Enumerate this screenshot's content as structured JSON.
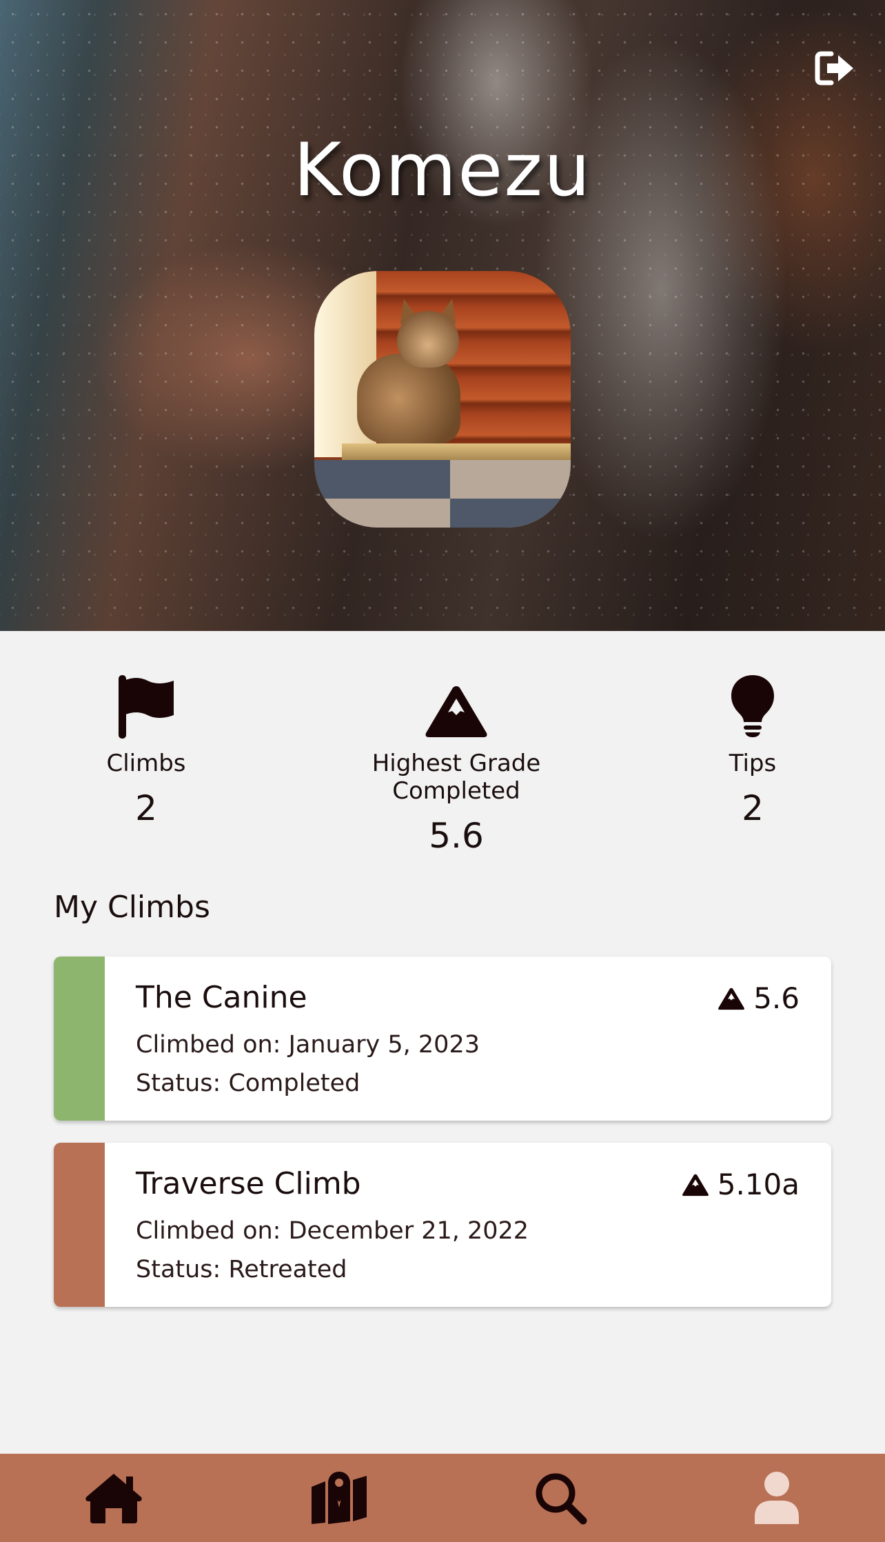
{
  "profile": {
    "username": "Komezu",
    "avatar_alt": "cat on stairs profile photo",
    "logout_icon": "logout-icon"
  },
  "stats": {
    "climbs_label": "Climbs",
    "climbs_value": "2",
    "grade_label": "Highest Grade Completed",
    "grade_value": "5.6",
    "tips_label": "Tips",
    "tips_value": "2"
  },
  "my_climbs": {
    "title": "My Climbs",
    "items": [
      {
        "name": "The Canine",
        "grade": "5.6",
        "climbed_on": "Climbed on: January 5, 2023",
        "status": "Status: Completed",
        "color": "#8db56d"
      },
      {
        "name": "Traverse Climb",
        "grade": "5.10a",
        "climbed_on": "Climbed on: December 21, 2022",
        "status": "Status: Retreated",
        "color": "#b97156"
      }
    ]
  },
  "nav": {
    "items": [
      "home-icon",
      "map-icon",
      "search-icon",
      "user-icon"
    ],
    "background": "#b97156",
    "active_color": "#f0d8cf"
  }
}
